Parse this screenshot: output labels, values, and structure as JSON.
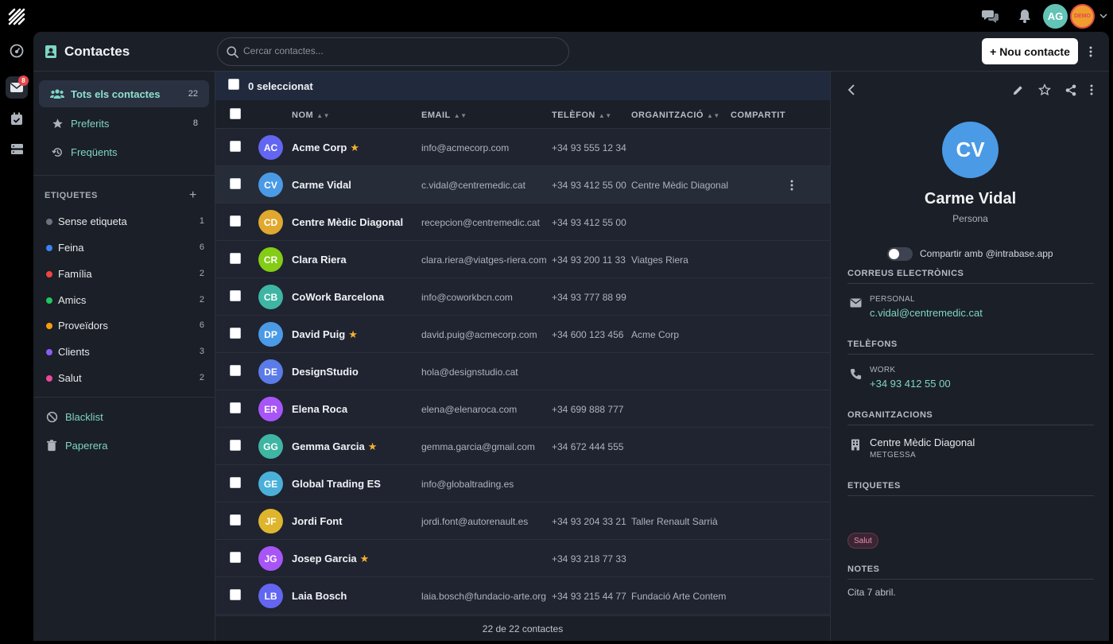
{
  "rail": {
    "mail_badge": "8"
  },
  "topbar": {
    "user_initials": "AG",
    "demo_label": "DEMO"
  },
  "header": {
    "title": "Contactes",
    "search_placeholder": "Cercar contactes...",
    "new_button": "+ Nou contacte"
  },
  "sidebar": {
    "nav": [
      {
        "label": "Tots els contactes",
        "count": "22"
      },
      {
        "label": "Preferits",
        "count": "8"
      },
      {
        "label": "Freqüents",
        "count": ""
      }
    ],
    "tags_title": "ETIQUETES",
    "tags_add": "+",
    "tags": [
      {
        "label": "Sense etiqueta",
        "count": "1",
        "color": "#6b7280"
      },
      {
        "label": "Feina",
        "count": "6",
        "color": "#3b82f6"
      },
      {
        "label": "Família",
        "count": "2",
        "color": "#ef4444"
      },
      {
        "label": "Amics",
        "count": "2",
        "color": "#22c55e"
      },
      {
        "label": "Proveïdors",
        "count": "6",
        "color": "#f59e0b"
      },
      {
        "label": "Clients",
        "count": "3",
        "color": "#8b5cf6"
      },
      {
        "label": "Salut",
        "count": "2",
        "color": "#ec4899"
      }
    ],
    "blacklist": "Blacklist",
    "trash": "Paperera"
  },
  "list": {
    "selected_text": "0 seleccionat",
    "columns": {
      "name": "NOM",
      "email": "EMAIL",
      "phone": "TELÈFON",
      "org": "ORGANITZACIÓ",
      "shared": "COMPARTIT"
    },
    "rows": [
      {
        "initials": "AC",
        "color": "#6366f1",
        "name": "Acme Corp",
        "star": true,
        "email": "info@acmecorp.com",
        "phone": "+34 93 555 12 34",
        "org": ""
      },
      {
        "initials": "CV",
        "color": "#4a9ae6",
        "name": "Carme Vidal",
        "star": false,
        "email": "c.vidal@centremedic.cat",
        "phone": "+34 93 412 55 00",
        "org": "Centre Mèdic Diagonal"
      },
      {
        "initials": "CD",
        "color": "#e0a82e",
        "name": "Centre Mèdic Diagonal",
        "star": false,
        "email": "recepcion@centremedic.cat",
        "phone": "+34 93 412 55 00",
        "org": ""
      },
      {
        "initials": "CR",
        "color": "#84cc16",
        "name": "Clara Riera",
        "star": false,
        "email": "clara.riera@viatges-riera.com",
        "phone": "+34 93 200 11 33",
        "org": "Viatges Riera"
      },
      {
        "initials": "CB",
        "color": "#3fb5a3",
        "name": "CoWork Barcelona",
        "star": false,
        "email": "info@coworkbcn.com",
        "phone": "+34 93 777 88 99",
        "org": ""
      },
      {
        "initials": "DP",
        "color": "#4a9ae6",
        "name": "David Puig",
        "star": true,
        "email": "david.puig@acmecorp.com",
        "phone": "+34 600 123 456",
        "org": "Acme Corp"
      },
      {
        "initials": "DE",
        "color": "#5b7be8",
        "name": "DesignStudio",
        "star": false,
        "email": "hola@designstudio.cat",
        "phone": "",
        "org": ""
      },
      {
        "initials": "ER",
        "color": "#a855f7",
        "name": "Elena Roca",
        "star": false,
        "email": "elena@elenaroca.com",
        "phone": "+34 699 888 777",
        "org": ""
      },
      {
        "initials": "GG",
        "color": "#3fb5a3",
        "name": "Gemma Garcia",
        "star": true,
        "email": "gemma.garcia@gmail.com",
        "phone": "+34 672 444 555",
        "org": ""
      },
      {
        "initials": "GE",
        "color": "#4ab0d9",
        "name": "Global Trading ES",
        "star": false,
        "email": "info@globaltrading.es",
        "phone": "",
        "org": ""
      },
      {
        "initials": "JF",
        "color": "#e0b52e",
        "name": "Jordi Font",
        "star": false,
        "email": "jordi.font@autorenault.es",
        "phone": "+34 93 204 33 21",
        "org": "Taller Renault Sarrià"
      },
      {
        "initials": "JG",
        "color": "#a855f7",
        "name": "Josep Garcia",
        "star": true,
        "email": "",
        "phone": "+34 93 218 77 33",
        "org": ""
      },
      {
        "initials": "LB",
        "color": "#6366f1",
        "name": "Laia Bosch",
        "star": false,
        "email": "laia.bosch@fundacio-arte.org",
        "phone": "+34 93 215 44 77",
        "org": "Fundació Arte Contem"
      }
    ],
    "footer": "22 de 22 contactes"
  },
  "detail": {
    "initials": "CV",
    "name": "Carme Vidal",
    "type": "Persona",
    "share_label": "Compartir amb @intrabase.app",
    "emails_title": "CORREUS ELECTRÒNICS",
    "email_kind": "PERSONAL",
    "email_value": "c.vidal@centremedic.cat",
    "phones_title": "TELÈFONS",
    "phone_kind": "WORK",
    "phone_value": "+34 93 412 55 00",
    "orgs_title": "ORGANITZACIONS",
    "org_name": "Centre Mèdic Diagonal",
    "org_role": "METGESSA",
    "tags_title": "ETIQUETES",
    "tag": "Salut",
    "notes_title": "NOTES",
    "note": "Cita 7 abril."
  }
}
